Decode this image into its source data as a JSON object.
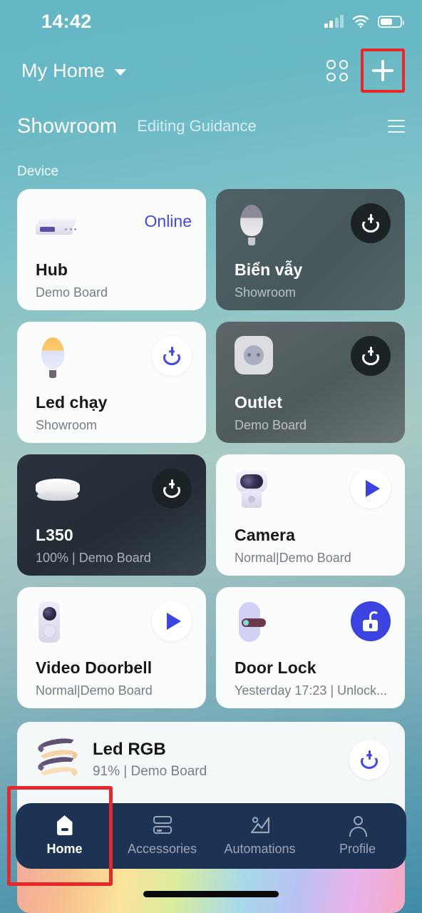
{
  "status_bar": {
    "time": "14:42",
    "signal_icon": "cellular-signal-icon",
    "wifi_icon": "wifi-icon",
    "battery_icon": "battery-icon",
    "battery_level_percent": 62
  },
  "header": {
    "home_name": "My Home",
    "caret_icon": "chevron-down-icon",
    "grid_icon": "grid-view-icon",
    "add_icon": "plus-icon",
    "highlight_color": "#e8272b"
  },
  "room_bar": {
    "active_room": "Showroom",
    "secondary_label": "Editing Guidance",
    "menu_icon": "hamburger-menu-icon"
  },
  "section": {
    "label": "Device"
  },
  "devices": [
    {
      "name": "Hub",
      "subtitle": "Demo Board",
      "status_text": "Online",
      "theme": "light",
      "icon": "hub-icon",
      "control": "status-text"
    },
    {
      "name": "Biển vẫy",
      "subtitle": "Showroom",
      "theme": "dark-teal",
      "icon": "bulb-off-icon",
      "control": "power-off-button"
    },
    {
      "name": "Led chạy",
      "subtitle": "Showroom",
      "theme": "light",
      "icon": "bulb-on-icon",
      "control": "power-on-button"
    },
    {
      "name": "Outlet",
      "subtitle": "Demo Board",
      "theme": "dark-gray",
      "icon": "outlet-icon",
      "control": "power-off-button"
    },
    {
      "name": "L350",
      "subtitle": "100% | Demo Board",
      "theme": "dark-navy",
      "icon": "ceiling-light-icon",
      "control": "power-off-button"
    },
    {
      "name": "Camera",
      "subtitle": "Normal|Demo Board",
      "theme": "light",
      "icon": "camera-icon",
      "control": "play-button"
    },
    {
      "name": "Video Doorbell",
      "subtitle": "Normal|Demo Board",
      "theme": "light",
      "icon": "doorbell-icon",
      "control": "play-button"
    },
    {
      "name": "Door Lock",
      "subtitle": "Yesterday 17:23 | Unlock...",
      "theme": "light",
      "icon": "door-lock-icon",
      "control": "unlock-button"
    }
  ],
  "rgb_card": {
    "name": "Led RGB",
    "subtitle": "91% | Demo Board",
    "icon": "led-strip-icon",
    "power_icon": "power-on-button",
    "brightness_percent": 91,
    "slider_fill_color": "#3b43ec"
  },
  "bottom_nav": {
    "items": [
      {
        "label": "Home",
        "icon": "home-icon",
        "active": true
      },
      {
        "label": "Accessories",
        "icon": "accessories-icon",
        "active": false
      },
      {
        "label": "Automations",
        "icon": "automations-icon",
        "active": false
      },
      {
        "label": "Profile",
        "icon": "profile-icon",
        "active": false
      }
    ],
    "highlight_color": "#e8272b",
    "background_color": "#1d3354"
  }
}
